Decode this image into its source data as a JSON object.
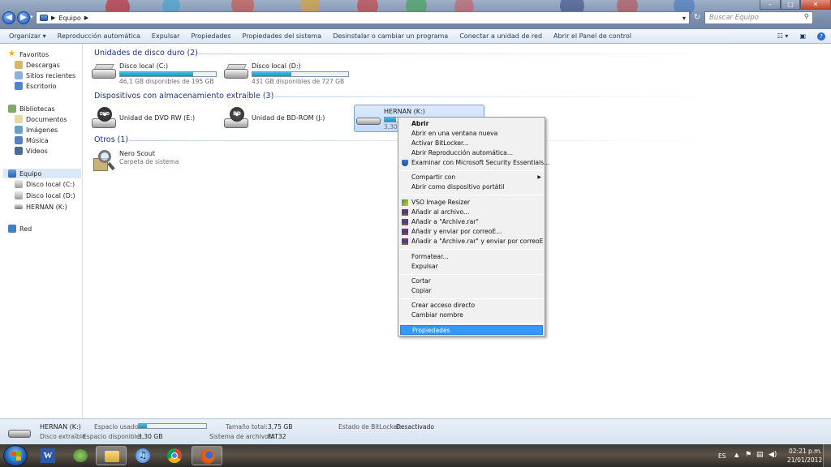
{
  "window": {
    "breadcrumb_root_icon": "computer-icon",
    "breadcrumb_item": "Equipo",
    "search_placeholder": "Buscar Equipo"
  },
  "toolbar": {
    "items": [
      "Organizar ▾",
      "Reproducción automática",
      "Expulsar",
      "Propiedades",
      "Propiedades del sistema",
      "Desinstalar o cambiar un programa",
      "Conectar a unidad de red",
      "Abrir el Panel de control"
    ]
  },
  "sidebar": {
    "favoritos": "Favoritos",
    "fav_items": [
      "Descargas",
      "Sitios recientes",
      "Escritorio"
    ],
    "bibliotecas": "Bibliotecas",
    "lib_items": [
      "Documentos",
      "Imágenes",
      "Música",
      "Vídeos"
    ],
    "equipo": "Equipo",
    "equipo_items": [
      "Disco local (C:)",
      "Disco local (D:)",
      "HERNAN (K:)"
    ],
    "red": "Red"
  },
  "groups": {
    "hdd": "Unidades de disco duro (2)",
    "removable": "Dispositivos con almacenamiento extraíble (3)",
    "others": "Otros (1)"
  },
  "drives": {
    "c": {
      "name": "Disco local (C:)",
      "free": "46,1 GB disponibles de 195 GB",
      "used_fraction": 0.76
    },
    "d": {
      "name": "Disco local (D:)",
      "free": "431 GB disponibles de 727 GB",
      "used_fraction": 0.41
    },
    "dvd": {
      "name": "Unidad de DVD RW (E:)",
      "badge": "DVD"
    },
    "bd": {
      "name": "Unidad de BD-ROM (J:)",
      "badge": "BD"
    },
    "k": {
      "name": "HERNAN (K:)",
      "free_partial": "3,30 G"
    },
    "nero": {
      "name": "Nero Scout",
      "sub": "Carpeta de sistema"
    }
  },
  "context_menu": {
    "items": [
      {
        "label": "Abrir",
        "bold": true
      },
      {
        "label": "Abrir en una ventana nueva"
      },
      {
        "label": "Activar BitLocker..."
      },
      {
        "label": "Abrir Reproducción automática..."
      },
      {
        "label": "Examinar con Microsoft Security Essentials...",
        "icon": "shield-icon"
      },
      {
        "label": "Compartir con",
        "submenu": true
      },
      {
        "label": "Abrir como dispositivo portátil"
      },
      {
        "label": "VSO Image Resizer",
        "icon": "image-resizer-icon"
      },
      {
        "label": "Añadir al archivo...",
        "icon": "winrar-icon"
      },
      {
        "label": "Añadir a \"Archive.rar\"",
        "icon": "winrar-icon"
      },
      {
        "label": "Añadir y enviar por correoE...",
        "icon": "winrar-icon"
      },
      {
        "label": "Añadir a \"Archive.rar\" y enviar por correoE",
        "icon": "winrar-icon"
      },
      {
        "label": "Formatear..."
      },
      {
        "label": "Expulsar"
      },
      {
        "label": "Cortar"
      },
      {
        "label": "Copiar"
      },
      {
        "label": "Crear acceso directo"
      },
      {
        "label": "Cambiar nombre"
      },
      {
        "label": "Propiedades",
        "highlighted": true
      }
    ]
  },
  "details": {
    "name": "HERNAN (K:)",
    "type": "Disco extraíble",
    "used_label": "Espacio usado:",
    "used_fraction": 0.12,
    "free_label": "Espacio disponible:",
    "free_value": "3,30 GB",
    "total_label": "Tamaño total:",
    "total_value": "3,75 GB",
    "fs_label": "Sistema de archivos:",
    "fs_value": "FAT32",
    "bitlocker_label": "Estado de BitLocker:",
    "bitlocker_value": "Desactivado"
  },
  "taskbar": {
    "lang": "ES",
    "time": "02:21 p.m.",
    "date": "21/01/2012"
  },
  "colors": {
    "accent": "#3399ff",
    "menu_highlight": "#3399ff",
    "bar_fill": "#26a0da",
    "group_header": "#1e3287"
  }
}
